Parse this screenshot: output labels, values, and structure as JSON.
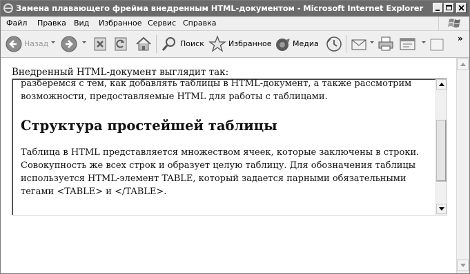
{
  "window": {
    "title": "Замена плавающего фрейма внедренным HTML-документом - Microsoft Internet Explorer"
  },
  "menu": [
    {
      "label": "Файл"
    },
    {
      "label": "Правка"
    },
    {
      "label": "Вид"
    },
    {
      "label": "Избранное"
    },
    {
      "label": "Сервис"
    },
    {
      "label": "Справка"
    }
  ],
  "toolbar": {
    "back_label": "Назад",
    "search_label": "Поиск",
    "favorites_label": "Избранное",
    "media_label": "Медиа",
    "overflow": "»"
  },
  "page": {
    "intro": "Внедренный HTML-документ выглядит так:",
    "iframe": {
      "para1": "разберемся с тем, как добавлять таблицы в HTML-документ, а также рассмотрим возможности, предоставляемые HTML для работы с таблицами.",
      "heading": "Структура простейшей таблицы",
      "para2": "Таблица в HTML представляется множеством ячеек, которые заключены в строки. Совокупность же всех строк и образует целую таблицу. Для обозначения таблицы используется HTML-элемент TABLE, который задается парными обязательными тегами <TABLE> и </TABLE>."
    }
  }
}
